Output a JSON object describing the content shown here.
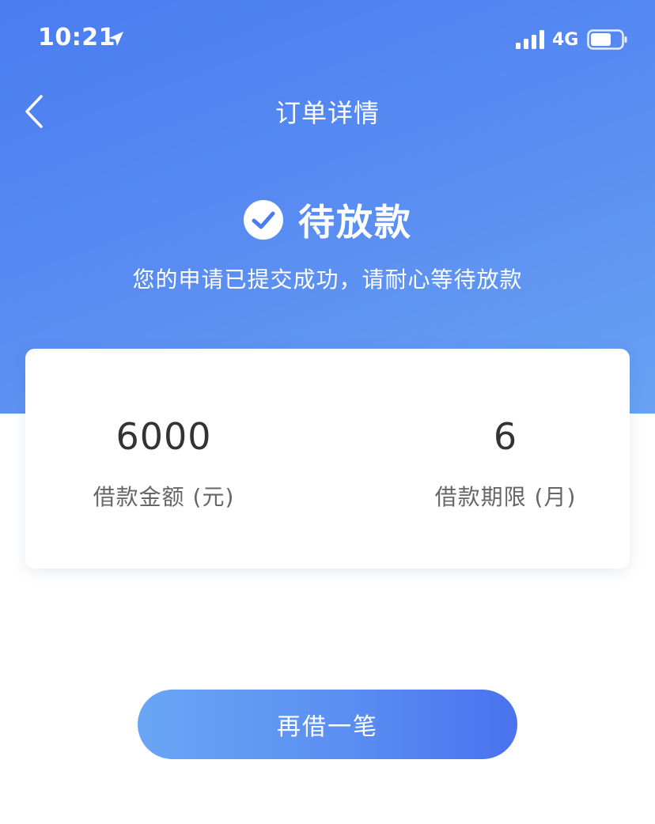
{
  "status_bar": {
    "time": "10:21",
    "network": "4G",
    "icons": [
      "location-arrow-icon",
      "signal-bars-icon",
      "battery-icon"
    ]
  },
  "nav": {
    "title": "订单详情",
    "back_icon": "chevron-left-icon"
  },
  "status": {
    "icon": "check-circle-icon",
    "title": "待放款",
    "description": "您的申请已提交成功，请耐心等待放款"
  },
  "summary": {
    "amount": {
      "value": "6000",
      "label": "借款金额 (元)"
    },
    "term": {
      "value": "6",
      "label": "借款期限 (月)"
    }
  },
  "actions": {
    "borrow_again_label": "再借一笔"
  },
  "colors": {
    "primary": "#4a7cf0",
    "primary_light": "#69a2f3",
    "text_dark": "#333333",
    "text_muted": "#666666"
  }
}
